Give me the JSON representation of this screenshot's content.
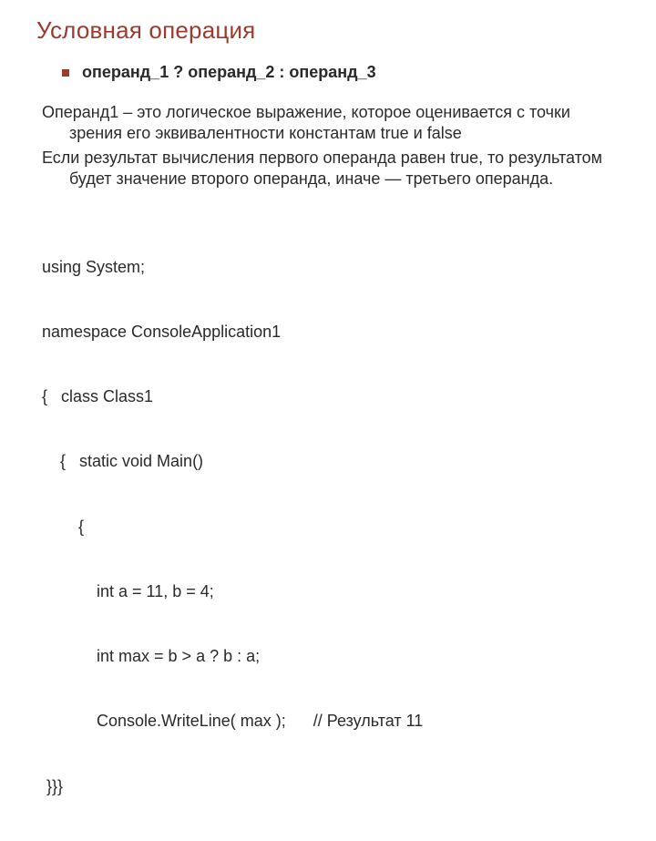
{
  "title": "Условная операция",
  "bullet": "операнд_1 ? операнд_2 : операнд_3",
  "para1": "Операнд1 – это логическое  выражение, которое оценивается с точки зрения его эквивалентности константам true и false",
  "para2": "Если результат вычисления первого операнда равен true, то результатом будет значение второго операнда, иначе — третьего операнда.",
  "code": {
    "l1": "using System;",
    "l2": "namespace ConsoleApplication1",
    "l3": "{   class Class1",
    "l4": "    {   static void Main()",
    "l5": "        {",
    "l6": "            int a = 11, b = 4;",
    "l7": "            int max = b > a ? b : a;",
    "l8": "            Console.WriteLine( max );      // Результат 11",
    "l9": " }}}"
  }
}
